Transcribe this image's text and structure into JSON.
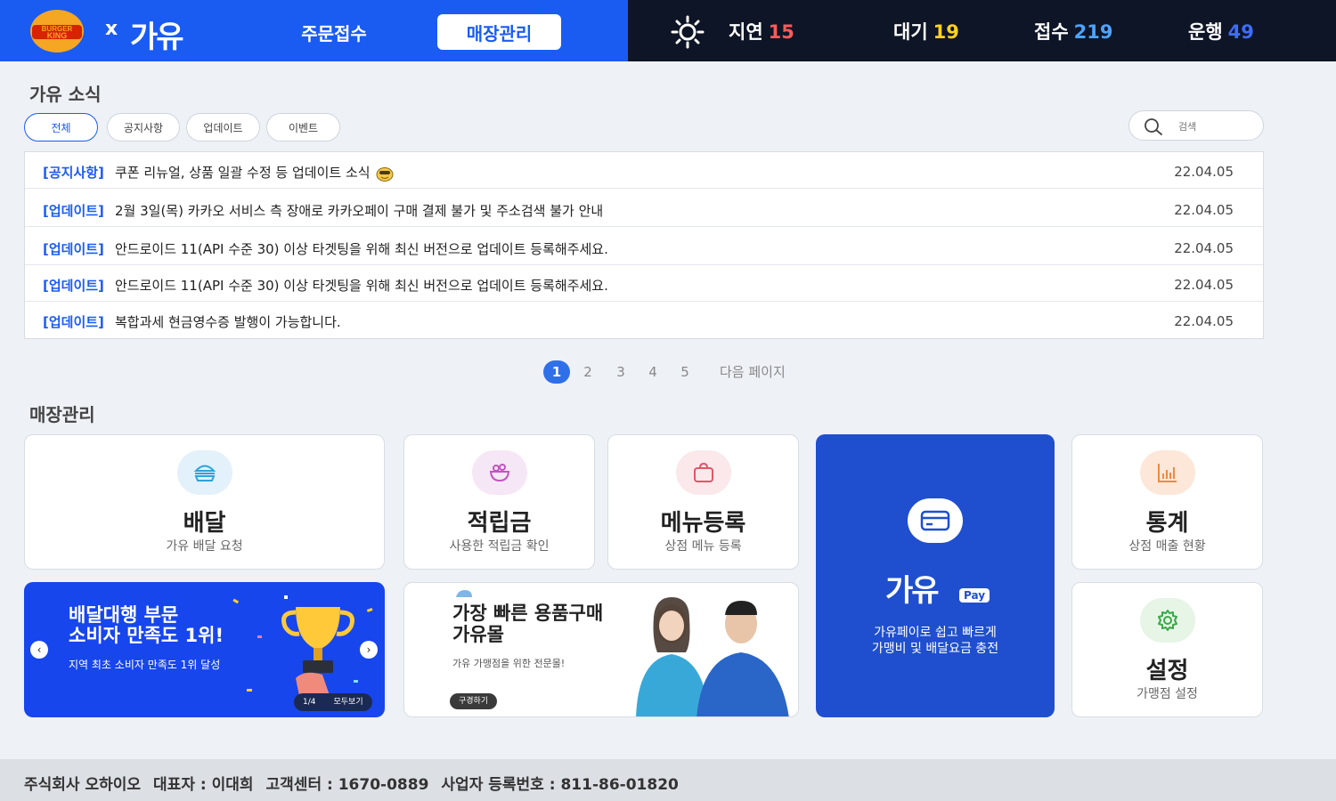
{
  "header": {
    "bk_logo_text": "BURGER KING",
    "x_sign": "x",
    "gayu_logo": "가유",
    "nav": {
      "order": "주문접수",
      "store": "매장관리"
    },
    "stats": [
      {
        "label": "지연",
        "value": "15",
        "color": "#ff5a5a"
      },
      {
        "label": "대기",
        "value": "19",
        "color": "#ffd21f"
      },
      {
        "label": "접수",
        "value": "219",
        "color": "#4da3ff"
      },
      {
        "label": "운행",
        "value": "49",
        "color": "#3d6cff"
      }
    ],
    "weather_icon": "sun-icon"
  },
  "news": {
    "title": "가유 소식",
    "filters": [
      "전체",
      "공지사항",
      "업데이트",
      "이벤트"
    ],
    "search_placeholder": "검색",
    "items": [
      {
        "tag": "[공지사항]",
        "text": "쿠폰 리뉴얼, 상품 일괄 수정 등 업데이트 소식",
        "date": "22.04.05",
        "emoji": "emoji-icon"
      },
      {
        "tag": "[업데이트]",
        "text": "2월 3일(목) 카카오 서비스 측 장애로 카카오페이 구매 결제 불가 및 주소검색 불가 안내",
        "date": "22.04.05"
      },
      {
        "tag": "[업데이트]",
        "text": "안드로이드 11(API 수준 30) 이상 타겟팅을 위해 최신 버전으로 업데이트 등록해주세요.",
        "date": "22.04.05"
      },
      {
        "tag": "[업데이트]",
        "text": "안드로이드 11(API 수준 30) 이상 타겟팅을 위해 최신 버전으로 업데이트 등록해주세요.",
        "date": "22.04.05"
      },
      {
        "tag": "[업데이트]",
        "text": "복합과세 현금영수증 발행이 가능합니다.",
        "date": "22.04.05"
      }
    ],
    "pages": [
      "1",
      "2",
      "3",
      "4",
      "5"
    ],
    "next_page": "다음 페이지"
  },
  "store": {
    "title": "매장관리",
    "cards": {
      "delivery": {
        "title": "배달",
        "sub": "가유 배달 요청",
        "icon": "burger-icon",
        "color": "#e3f1fb"
      },
      "points": {
        "title": "적립금",
        "sub": "사용한 적립금 확인",
        "icon": "salad-icon",
        "color": "#f6e7f6"
      },
      "menu": {
        "title": "메뉴등록",
        "sub": "상점 메뉴 등록",
        "icon": "bag-icon",
        "color": "#fbe8ea"
      },
      "stats": {
        "title": "통계",
        "sub": "상점 매출 현황",
        "icon": "chart-icon",
        "color": "#fde7d9"
      },
      "settings": {
        "title": "설정",
        "sub": "가맹점 설정",
        "icon": "gear-icon",
        "color": "#e6f5e6"
      }
    },
    "pay": {
      "logo": "가유",
      "badge": "Pay",
      "line1": "가유페이로 쉽고 빠르게",
      "line2": "가맹비 및 배달요금 충전",
      "icon": "card-icon"
    },
    "banner1": {
      "title_line1": "배달대행 부문",
      "title_line2": "소비자 만족도 1위!",
      "sub": "지역 최초 소비자 만족도 1위 달성",
      "counter": "1/4",
      "view_all": "모두보기"
    },
    "banner2": {
      "title_line1": "가장 빠른 용품구매",
      "title_line2": "가유몰",
      "sub": "가유 가맹점을 위한 전문몰!",
      "button": "구경하기"
    }
  },
  "footer": {
    "company": "주식회사 오하이오",
    "ceo": "대표자 : 이대희",
    "support": "고객센터 : 1670-0889",
    "biz_no": "사업자 등록번호 : 811-86-01820"
  }
}
